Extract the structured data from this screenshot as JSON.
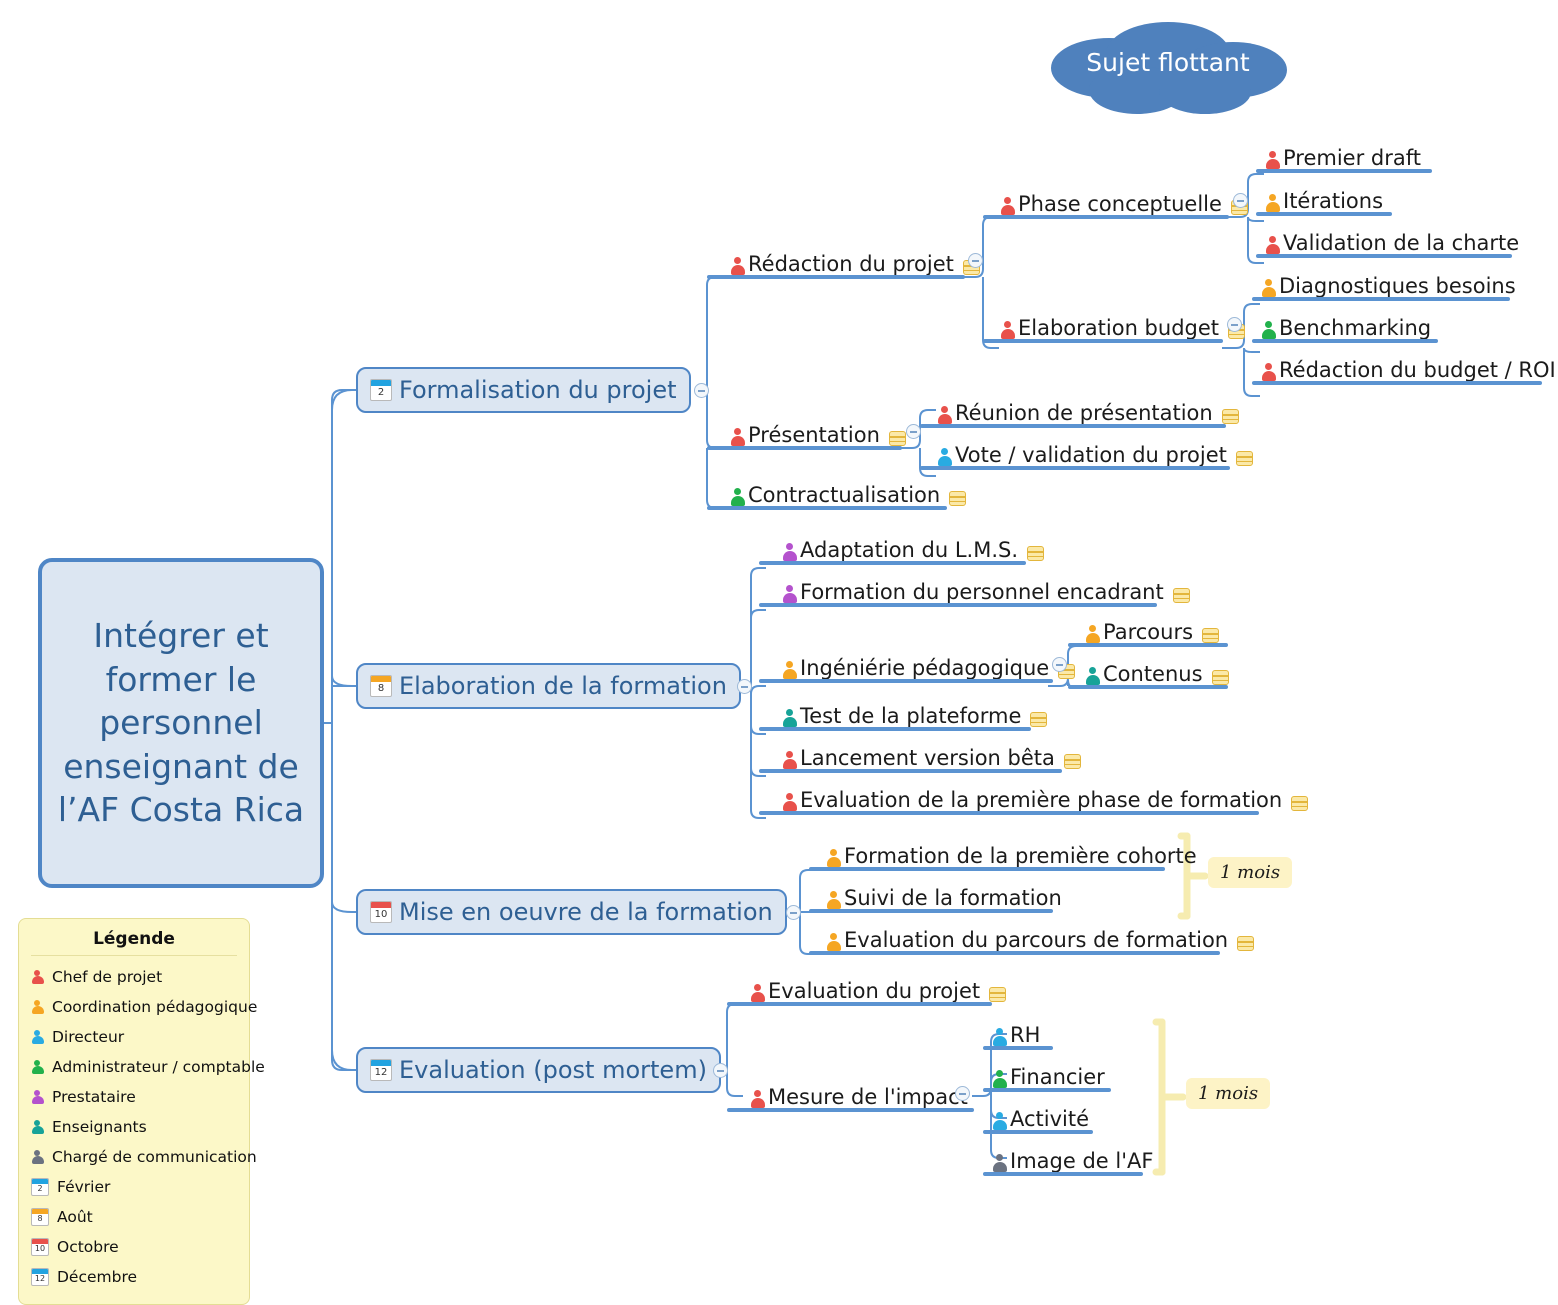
{
  "root": {
    "text": "Intégrer et former le personnel enseignant de l’AF Costa Rica"
  },
  "floating_topic": {
    "label": "Sujet flottant",
    "color": "#4f81bd"
  },
  "branches": [
    {
      "label": "Formalisation du projet",
      "month_num": "2",
      "month_color": "#22a3e0"
    },
    {
      "label": "Elaboration de la formation",
      "month_num": "8",
      "month_color": "#f5a623"
    },
    {
      "label": "Mise en oeuvre de la formation",
      "month_num": "10",
      "month_color": "#e8514b"
    },
    {
      "label": "Evaluation (post mortem)",
      "month_num": "12",
      "month_color": "#22a3e0"
    }
  ],
  "topics": {
    "redaction_du_projet": {
      "label": "Rédaction du projet",
      "role_color": "#e8514b",
      "notes": true
    },
    "phase_conceptuelle": {
      "label": "Phase conceptuelle",
      "role_color": "#e8514b",
      "notes": true
    },
    "premier_draft": {
      "label": "Premier draft",
      "role_color": "#e8514b",
      "notes": false
    },
    "iterations": {
      "label": "Itérations",
      "role_color": "#f5a623",
      "notes": false
    },
    "validation_de_la_charte": {
      "label": "Validation de la charte",
      "role_color": "#e8514b",
      "notes": false
    },
    "elaboration_budget": {
      "label": "Elaboration budget",
      "role_color": "#e8514b",
      "notes": true
    },
    "diagnostiques_besoins": {
      "label": "Diagnostiques besoins",
      "role_color": "#f5a623",
      "notes": false
    },
    "benchmarking": {
      "label": "Benchmarking",
      "role_color": "#22b14c",
      "notes": false
    },
    "redaction_du_budget_roi": {
      "label": "Rédaction du budget / ROI",
      "role_color": "#e8514b",
      "notes": false
    },
    "presentation": {
      "label": "Présentation",
      "role_color": "#e8514b",
      "notes": true
    },
    "reunion_de_presentation": {
      "label": "Réunion de présentation",
      "role_color": "#e8514b",
      "notes": true
    },
    "vote_validation_du_projet": {
      "label": "Vote / validation du projet",
      "role_color": "#29abe2",
      "notes": true
    },
    "contractualisation": {
      "label": "Contractualisation",
      "role_color": "#22b14c",
      "notes": true
    },
    "adaptation_du_lms": {
      "label": "Adaptation du L.M.S.",
      "role_color": "#b452cd",
      "notes": true
    },
    "formation_personnel_encadrant": {
      "label": "Formation du personnel encadrant",
      "role_color": "#b452cd",
      "notes": true
    },
    "ingenierie_pedagogique": {
      "label": "Ingéniérie pédagogique",
      "role_color": "#f5a623",
      "notes": true
    },
    "parcours": {
      "label": "Parcours",
      "role_color": "#f5a623",
      "notes": true
    },
    "contenus": {
      "label": "Contenus",
      "role_color": "#17a398",
      "notes": true
    },
    "test_de_la_plateforme": {
      "label": "Test de la plateforme",
      "role_color": "#17a398",
      "notes": true
    },
    "lancement_version_beta": {
      "label": "Lancement version bêta",
      "role_color": "#e8514b",
      "notes": true
    },
    "evaluation_premiere_phase": {
      "label": "Evaluation de la première phase de formation",
      "role_color": "#e8514b",
      "notes": true
    },
    "formation_premiere_cohorte": {
      "label": "Formation de la première cohorte",
      "role_color": "#f5a623",
      "notes": false
    },
    "suivi_de_la_formation": {
      "label": "Suivi de la formation",
      "role_color": "#f5a623",
      "notes": false
    },
    "evaluation_parcours": {
      "label": "Evaluation du parcours de formation",
      "role_color": "#f5a623",
      "notes": true
    },
    "evaluation_du_projet": {
      "label": "Evaluation du projet",
      "role_color": "#e8514b",
      "notes": true
    },
    "mesure_de_limpact": {
      "label": "Mesure de l'impact",
      "role_color": "#e8514b",
      "notes": false
    },
    "rh": {
      "label": "RH",
      "role_color": "#29abe2",
      "notes": false
    },
    "financier": {
      "label": "Financier",
      "role_color": "#22b14c",
      "notes": false
    },
    "activite": {
      "label": "Activité",
      "role_color": "#29abe2",
      "notes": false
    },
    "image_de_laf": {
      "label": "Image de l'AF",
      "role_color": "#6b7280",
      "notes": false
    }
  },
  "boundaries": [
    {
      "label": "1 mois"
    },
    {
      "label": "1 mois"
    }
  ],
  "legend": {
    "title": "Légende",
    "roles": [
      {
        "label": "Chef de projet",
        "color": "#e8514b"
      },
      {
        "label": "Coordination pédagogique",
        "color": "#f5a623"
      },
      {
        "label": "Directeur",
        "color": "#29abe2"
      },
      {
        "label": "Administrateur / comptable",
        "color": "#22b14c"
      },
      {
        "label": "Prestataire",
        "color": "#b452cd"
      },
      {
        "label": "Enseignants",
        "color": "#17a398"
      },
      {
        "label": "Chargé de communication",
        "color": "#6b7280"
      }
    ],
    "months": [
      {
        "label": "Février",
        "num": "2",
        "color": "#22a3e0"
      },
      {
        "label": "Août",
        "num": "8",
        "color": "#f5a623"
      },
      {
        "label": "Octobre",
        "num": "10",
        "color": "#e8514b"
      },
      {
        "label": "Décembre",
        "num": "12",
        "color": "#22a3e0"
      }
    ]
  }
}
